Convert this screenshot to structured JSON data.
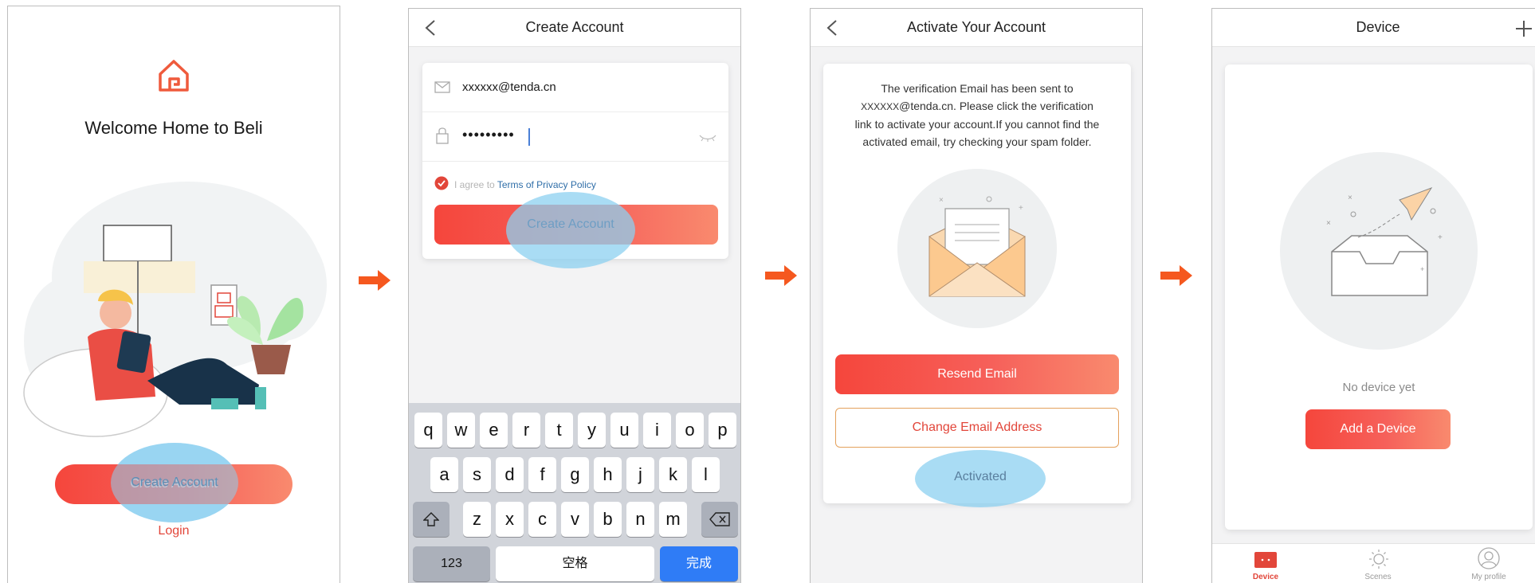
{
  "screen1": {
    "title": "Welcome Home to Beli",
    "create_account_label": "Create Account",
    "login_label": "Login"
  },
  "screen2": {
    "nav_title": "Create Account",
    "email_value": "xxxxxx@tenda.cn",
    "password_value": "•••••••••",
    "agree_prefix": "I agree to",
    "agree_link": "Terms of Privacy Policy",
    "create_account_label": "Create Account",
    "keyboard": {
      "row1": [
        "q",
        "w",
        "e",
        "r",
        "t",
        "y",
        "u",
        "i",
        "o",
        "p"
      ],
      "row2": [
        "a",
        "s",
        "d",
        "f",
        "g",
        "h",
        "j",
        "k",
        "l"
      ],
      "row3": [
        "z",
        "x",
        "c",
        "v",
        "b",
        "n",
        "m"
      ],
      "numbers_key": "123",
      "space_key": "空格",
      "done_key": "完成"
    }
  },
  "screen3": {
    "nav_title": "Activate Your Account",
    "message_line1": "The verification Email has been sent to",
    "message_email_prefix": "XXXXXX",
    "message_email_domain": "@tenda.cn",
    "message_line2_rest": ". Please click the verification",
    "message_line3": "link to activate your account.If you cannot find the",
    "message_line4": "activated email, try checking your spam folder.",
    "resend_label": "Resend Email",
    "change_email_label": "Change Email Address",
    "activated_label": "Activated"
  },
  "screen4": {
    "nav_title": "Device",
    "empty_text": "No device yet",
    "add_device_label": "Add a Device",
    "tabs": [
      {
        "label": "Device",
        "active": true
      },
      {
        "label": "Scenes",
        "active": false
      },
      {
        "label": "My profile",
        "active": false
      }
    ]
  },
  "colors": {
    "accent": "#f5463c",
    "arrow": "#f5581f",
    "highlight": "#8cd0f0",
    "link": "#2f6ea8"
  }
}
